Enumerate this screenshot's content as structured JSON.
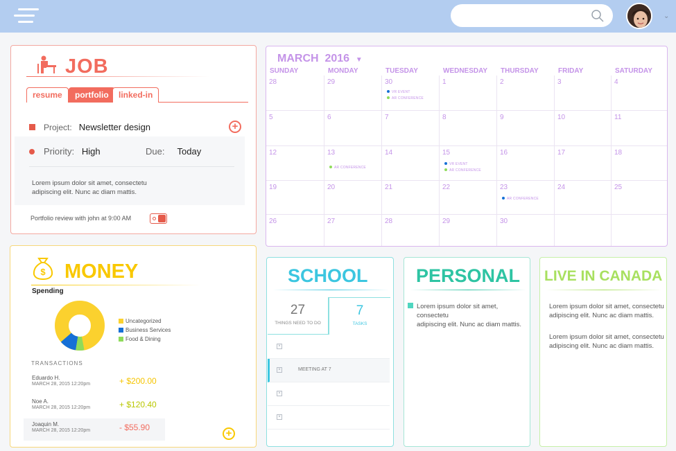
{
  "search": {
    "placeholder": ""
  },
  "job": {
    "title": "JOB",
    "tabs": [
      "resume",
      "portfolio",
      "linked-in"
    ],
    "project_label": "Project:",
    "project_value": "Newsletter design",
    "priority_label": "Priority:",
    "priority_value": "High",
    "due_label": "Due:",
    "due_value": "Today",
    "description_line1": "Lorem ipsum dolor sit amet, consectetu",
    "description_line2": "adipiscing elit. Nunc ac diam mattis.",
    "reminder": "Portfolio review with john at 9:00 AM"
  },
  "money": {
    "title": "MONEY",
    "spending_label": "Spending",
    "legend": [
      "Uncategorized",
      "Business Services",
      "Food & Dining"
    ],
    "transactions_label": "TRANSACTIONS",
    "transactions": [
      {
        "name": "Eduardo H.",
        "date": "MARCH 28, 2015 12:20pm",
        "amount": "+ $200.00"
      },
      {
        "name": "Noe A.",
        "date": "MARCH 28, 2015 12:20pm",
        "amount": "+ $120.40"
      },
      {
        "name": "Joaquin M.",
        "date": "MARCH 28, 2015 12:20pm",
        "amount": "- $55.90"
      }
    ]
  },
  "calendar": {
    "month": "MARCH",
    "year": "2016",
    "days": [
      "SUNDAY",
      "MONDAY",
      "TUESDAY",
      "WEDNESDAY",
      "THURSDAY",
      "FRIDAY",
      "SATURDAY"
    ],
    "weeks": [
      [
        "28",
        "29",
        "30",
        "1",
        "2",
        "3",
        "4"
      ],
      [
        "5",
        "6",
        "7",
        "8",
        "9",
        "10",
        "11"
      ],
      [
        "12",
        "13",
        "14",
        "15",
        "16",
        "17",
        "18"
      ],
      [
        "19",
        "20",
        "21",
        "22",
        "23",
        "24",
        "25"
      ],
      [
        "26",
        "27",
        "28",
        "29",
        "30",
        "",
        ""
      ]
    ],
    "events": {
      "vr_event": "VR EVENT",
      "ar_conference": "AR CONFERENCE"
    }
  },
  "school": {
    "title": "SCHOOL",
    "things_count": "27",
    "things_label": "THINGS NEED TO DO",
    "tasks_count": "7",
    "tasks_label": "TASKS",
    "task_meeting": "MEETING AT 7"
  },
  "personal": {
    "title": "PERSONAL",
    "line1": "Lorem ipsum dolor sit amet, consectetu",
    "line2": "adipiscing elit. Nunc ac diam mattis."
  },
  "canada": {
    "title": "LIVE IN CANADA",
    "p1_line1": "Lorem ipsum dolor sit amet, consectetu",
    "p1_line2": "adipiscing elit. Nunc ac diam mattis.",
    "p2_line1": "Lorem ipsum dolor sit amet, consectetu",
    "p2_line2": "adipiscing elit. Nunc ac diam mattis."
  },
  "colors": {
    "job": "#f26c5e",
    "money": "#f9c800",
    "calendar": "#c493e8",
    "school": "#3cc6e0",
    "personal": "#2ec4a3",
    "canada": "#a8e05f"
  }
}
